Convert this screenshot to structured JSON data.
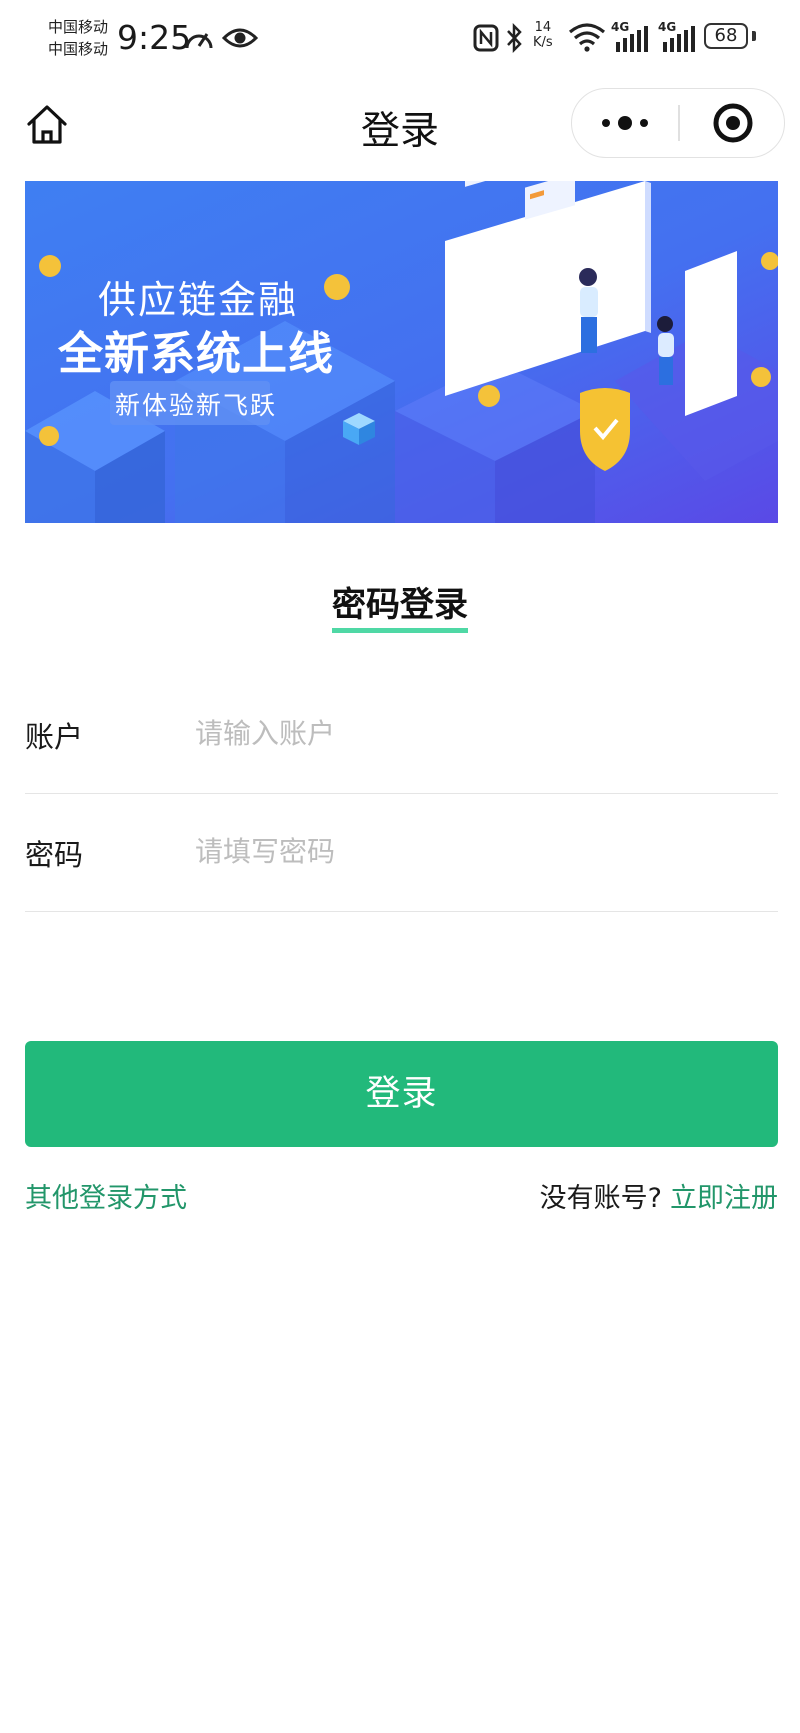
{
  "status_bar": {
    "carrier_1": "中国移动",
    "carrier_2": "中国移动",
    "time": "9:25",
    "net_speed_value": "14",
    "net_speed_unit": "K/s",
    "signal_1_label": "4G",
    "signal_2_label": "4G",
    "battery": "68",
    "icons": [
      "speedometer-icon",
      "eye-icon",
      "nfc-icon",
      "bluetooth-icon",
      "wifi-icon",
      "cellular-signal-icon",
      "battery-icon"
    ]
  },
  "nav": {
    "title": "登录",
    "icons": [
      "home-icon",
      "more-dots-icon",
      "target-close-icon"
    ]
  },
  "banner": {
    "line1": "供应链金融",
    "line2": "全新系统上线",
    "line3": "新体验新飞跃"
  },
  "login_tab": {
    "label": "密码登录",
    "underline_color": "#4fd8a5"
  },
  "form": {
    "account_label": "账户",
    "account_placeholder": "请输入账户",
    "password_label": "密码",
    "password_placeholder": "请填写密码"
  },
  "login_button": {
    "label": "登录",
    "color": "#22b97b"
  },
  "footer": {
    "other_login": "其他登录方式",
    "no_account": "没有账号?",
    "register": "立即注册",
    "link_color": "#22966a"
  }
}
